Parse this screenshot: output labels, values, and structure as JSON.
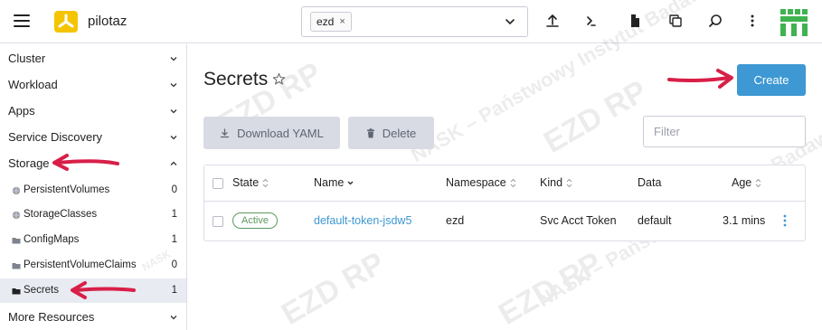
{
  "header": {
    "cluster_name": "pilotaz",
    "namespace_chip": "ezd",
    "namespace_chip_remove": "×",
    "icons": [
      "hamburger-icon",
      "cluster-logo-icon",
      "upload-icon",
      "terminal-icon",
      "file-icon",
      "copy-icon",
      "search-icon",
      "more-icon",
      "brand-logo"
    ]
  },
  "sidebar": {
    "groups": [
      {
        "label": "Cluster",
        "state": "collapsed"
      },
      {
        "label": "Workload",
        "state": "collapsed"
      },
      {
        "label": "Apps",
        "state": "collapsed"
      },
      {
        "label": "Service Discovery",
        "state": "collapsed"
      },
      {
        "label": "Storage",
        "state": "expanded"
      },
      {
        "label": "More Resources",
        "state": "collapsed"
      }
    ],
    "storage_items": [
      {
        "label": "PersistentVolumes",
        "count": "0",
        "icon": "globe-icon"
      },
      {
        "label": "StorageClasses",
        "count": "1",
        "icon": "globe-icon"
      },
      {
        "label": "ConfigMaps",
        "count": "1",
        "icon": "folder-icon"
      },
      {
        "label": "PersistentVolumeClaims",
        "count": "0",
        "icon": "folder-icon"
      },
      {
        "label": "Secrets",
        "count": "1",
        "icon": "folder-icon",
        "active": true
      }
    ]
  },
  "main": {
    "title": "Secrets",
    "create_label": "Create",
    "download_label": "Download YAML",
    "delete_label": "Delete",
    "filter_placeholder": "Filter",
    "table": {
      "columns": [
        "State",
        "Name",
        "Namespace",
        "Kind",
        "Data",
        "Age"
      ],
      "rows": [
        {
          "state": "Active",
          "name": "default-token-jsdw5",
          "namespace": "ezd",
          "kind": "Svc Acct Token",
          "data": "default",
          "age": "3.1 mins"
        }
      ]
    }
  },
  "colors": {
    "accent": "#3d98d3",
    "active_green": "#5d995d",
    "annotation_arrow": "#d81f48",
    "brand_green": "#3fb34f",
    "cluster_logo": "#f5c400"
  },
  "watermark": [
    "NASK – Państwowy Instytut Badawczy",
    "EZD RP",
    "NASK"
  ]
}
